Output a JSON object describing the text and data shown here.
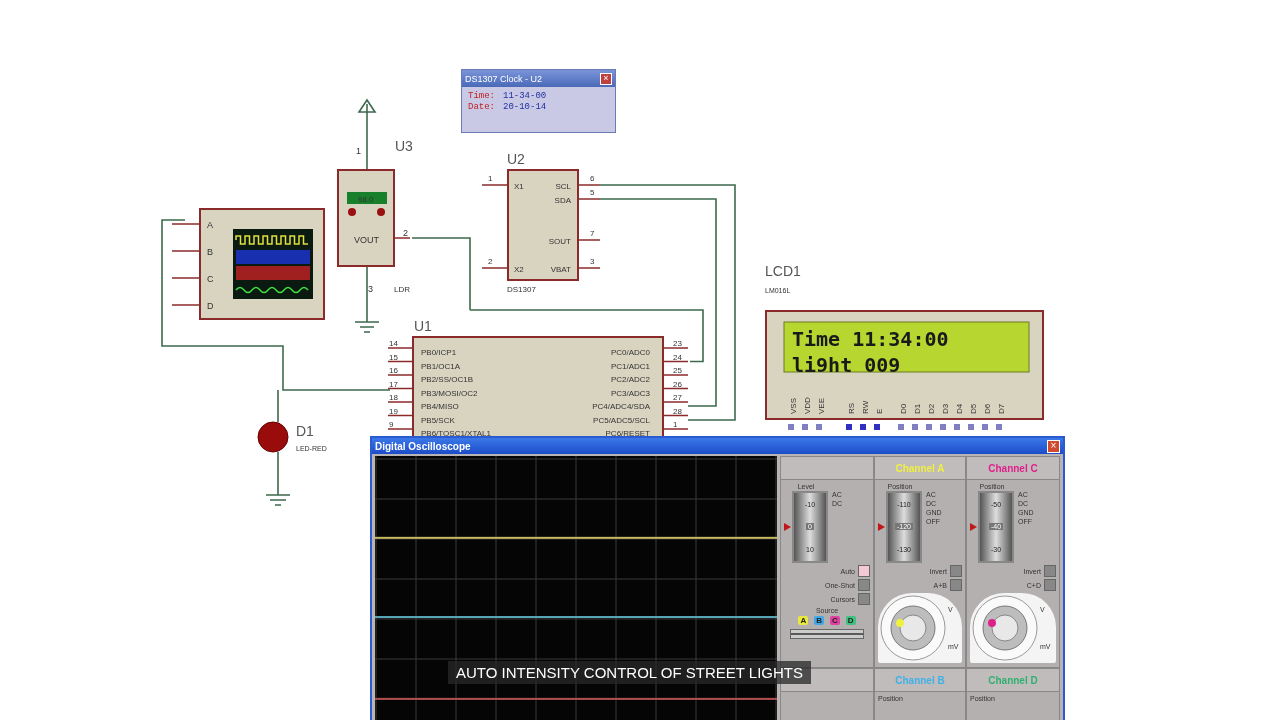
{
  "clock_popup": {
    "title": "DS1307 Clock - U2",
    "close": "×",
    "rows": [
      {
        "label": "Time:",
        "value": "11-34-00"
      },
      {
        "label": "Date:",
        "value": "20-10-14"
      }
    ]
  },
  "logic_analyzer": {
    "pins": [
      "A",
      "B",
      "C",
      "D"
    ]
  },
  "ldr": {
    "designator": "U3",
    "value": "LDR",
    "display": "98.0",
    "pin_label": "VOUT",
    "pins": [
      "1",
      "2",
      "3"
    ]
  },
  "rtc": {
    "designator": "U2",
    "part": "DS1307",
    "left_pins": [
      {
        "num": "1",
        "name": "X1"
      },
      {
        "num": "2",
        "name": "X2"
      }
    ],
    "right_pins": [
      {
        "num": "6",
        "name": "SCL"
      },
      {
        "num": "5",
        "name": "SDA"
      },
      {
        "num": "7",
        "name": "SOUT"
      },
      {
        "num": "3",
        "name": "VBAT"
      }
    ]
  },
  "mcu": {
    "designator": "U1",
    "left_pins": [
      {
        "num": "14",
        "name": "PB0/ICP1"
      },
      {
        "num": "15",
        "name": "PB1/OC1A"
      },
      {
        "num": "16",
        "name": "PB2/SS/OC1B"
      },
      {
        "num": "17",
        "name": "PB3/MOSI/OC2"
      },
      {
        "num": "18",
        "name": "PB4/MISO"
      },
      {
        "num": "19",
        "name": "PB5/SCK"
      },
      {
        "num": "9",
        "name": "PB6/TOSC1/XTAL1"
      }
    ],
    "right_pins": [
      {
        "num": "23",
        "name": "PC0/ADC0"
      },
      {
        "num": "24",
        "name": "PC1/ADC1"
      },
      {
        "num": "25",
        "name": "PC2/ADC2"
      },
      {
        "num": "26",
        "name": "PC3/ADC3"
      },
      {
        "num": "27",
        "name": "PC4/ADC4/SDA"
      },
      {
        "num": "28",
        "name": "PC5/ADC5/SCL"
      },
      {
        "num": "1",
        "name": "PC6/RESET"
      }
    ]
  },
  "lcd": {
    "designator": "LCD1",
    "part": "LM016L",
    "lines": [
      "Time 11:34:00",
      "li9ht  009"
    ],
    "pins": [
      "VSS",
      "VDD",
      "VEE",
      "RS",
      "RW",
      "E",
      "D0",
      "D1",
      "D2",
      "D3",
      "D4",
      "D5",
      "D6",
      "D7"
    ]
  },
  "led": {
    "designator": "D1",
    "part": "LED-RED"
  },
  "oscilloscope": {
    "title": "Digital Oscilloscope",
    "close": "×",
    "trigger": {
      "level_label": "Level",
      "level": 0.5,
      "scale": [
        "-10",
        "0",
        "10"
      ],
      "coupling": [
        "AC",
        "DC"
      ],
      "buttons": [
        {
          "label": "Auto",
          "on": true
        },
        {
          "label": "One-Shot",
          "on": false
        },
        {
          "label": "Cursors",
          "on": false
        }
      ],
      "source_label": "Source",
      "sources": [
        {
          "label": "A",
          "color": "#e8e840"
        },
        {
          "label": "B",
          "color": "#40a8e8"
        },
        {
          "label": "C",
          "color": "#e040a0"
        },
        {
          "label": "D",
          "color": "#40c080"
        }
      ]
    },
    "channels": [
      {
        "name": "Channel A",
        "color": "#f0f040",
        "position_label": "Position",
        "level": 0.5,
        "scale": [
          "-110",
          "-120",
          "-130"
        ],
        "coupling": [
          "AC",
          "DC",
          "GND",
          "OFF"
        ],
        "buttons": [
          "Invert",
          "A+B"
        ],
        "units": [
          "V",
          "mV"
        ]
      },
      {
        "name": "Channel C",
        "color": "#e0208a",
        "position_label": "Position",
        "level": 0.5,
        "scale": [
          "-50",
          "-40",
          "-30"
        ],
        "coupling": [
          "AC",
          "DC",
          "GND",
          "OFF"
        ],
        "buttons": [
          "Invert",
          "C+D"
        ],
        "units": [
          "V",
          "mV"
        ]
      }
    ],
    "lower_channels": [
      {
        "name": "Channel B",
        "color": "#40b0e8",
        "position_label": "Position"
      },
      {
        "name": "Channel D",
        "color": "#30b070",
        "position_label": "Position"
      }
    ],
    "traces": [
      {
        "color": "#c8b860"
      },
      {
        "color": "#5aa8b8"
      },
      {
        "color": "#b05050"
      }
    ]
  },
  "caption": "AUTO INTENSITY CONTROL OF STREET LIGHTS"
}
